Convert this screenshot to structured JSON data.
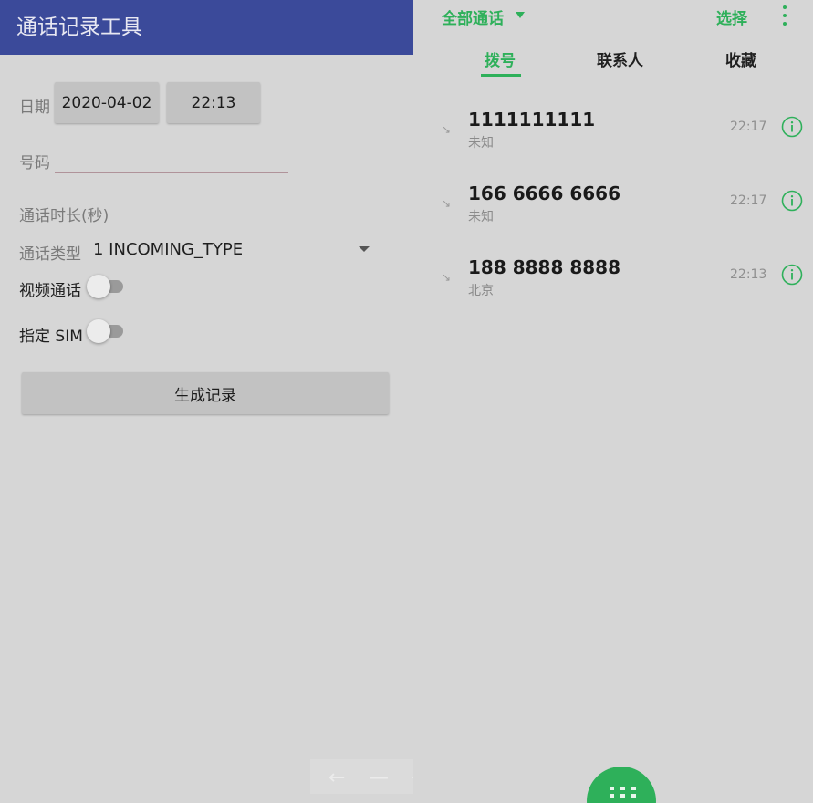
{
  "left_app": {
    "title": "通话记录工具",
    "date_label": "日期",
    "date_value": "2020-04-02",
    "time_value": "22:13",
    "number_label": "号码",
    "number_value": "",
    "duration_label": "通话时长(秒)",
    "duration_value": "",
    "type_label": "通话类型",
    "type_value": "1 INCOMING_TYPE",
    "video_label": "视频通话",
    "sim_label": "指定 SIM",
    "generate_label": "生成记录",
    "accent_color": "#3b4a9a"
  },
  "dialer": {
    "filter_label": "全部通话",
    "select_label": "选择",
    "tabs": [
      {
        "label": "拨号",
        "active": true
      },
      {
        "label": "联系人",
        "active": false
      },
      {
        "label": "收藏",
        "active": false
      }
    ],
    "calls": [
      {
        "number": "1111111111",
        "location": "未知",
        "time": "22:17"
      },
      {
        "number": "166 6666 6666",
        "location": "未知",
        "time": "22:17"
      },
      {
        "number": "188 8888 8888",
        "location": "北京",
        "time": "22:13"
      }
    ],
    "accent_color": "#2eb05a"
  },
  "overlay": {
    "icons": [
      "back-arrow-icon",
      "minus-icon",
      "plus-icon",
      "close-icon"
    ]
  }
}
